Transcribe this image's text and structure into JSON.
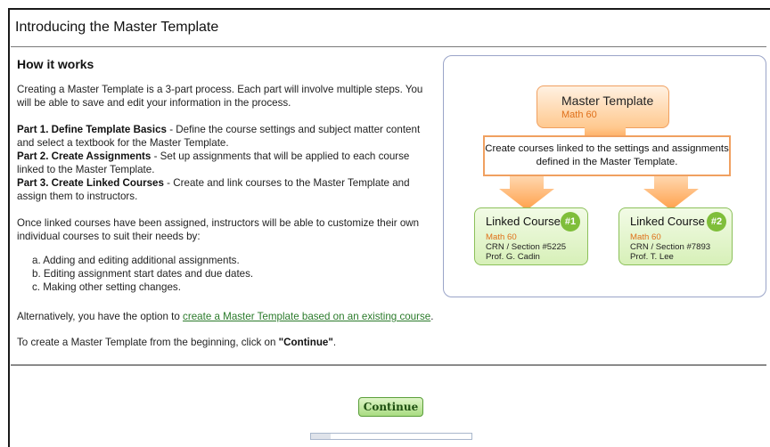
{
  "page": {
    "title": "Introducing the Master Template"
  },
  "how_it_works": {
    "heading": "How it works",
    "intro": "Creating a Master Template is a 3-part process. Each part will involve multiple steps. You will be able to save and edit your information in the process.",
    "parts": [
      {
        "label": "Part 1. Define Template Basics",
        "text": " - Define the course settings and subject matter content and select a textbook for the Master Template."
      },
      {
        "label": "Part 2. Create Assignments",
        "text": " - Set up assignments that will be applied to each course linked to the Master Template."
      },
      {
        "label": "Part 3. Create Linked Courses",
        "text": " - Create and link courses to the Master Template and assign them to instructors."
      }
    ],
    "customize_intro": "Once linked courses have been assigned, instructors will be able to customize their own individual courses to suit their needs by:",
    "customize_items": [
      "a. Adding and editing additional assignments.",
      "b. Editing assignment start dates and due dates.",
      "c. Making other setting changes."
    ],
    "alternative_prefix": "Alternatively, you have the option to ",
    "alternative_link": "create a Master Template based on an existing course",
    "alternative_suffix": ".",
    "begin_prefix": "To create a Master Template from the beginning, click on ",
    "begin_bold": "\"Continue\"",
    "begin_suffix": "."
  },
  "diagram": {
    "master_title": "Master Template",
    "master_course": "Math 60",
    "link_text": "Create courses linked to the settings and assignments defined in the Master Template.",
    "courses": [
      {
        "title": "Linked Course",
        "number": "#1",
        "course": "Math 60",
        "crn": "CRN / Section #5225",
        "prof": "Prof. G. Cadin"
      },
      {
        "title": "Linked Course",
        "number": "#2",
        "course": "Math 60",
        "crn": "CRN / Section #7893",
        "prof": "Prof. T. Lee"
      }
    ],
    "colors": {
      "orange": "#f0a060",
      "green": "#8cc05a",
      "accent_text": "#e0701a"
    }
  },
  "actions": {
    "continue_label": "Continue"
  },
  "progress": {
    "fraction": 0.12
  }
}
